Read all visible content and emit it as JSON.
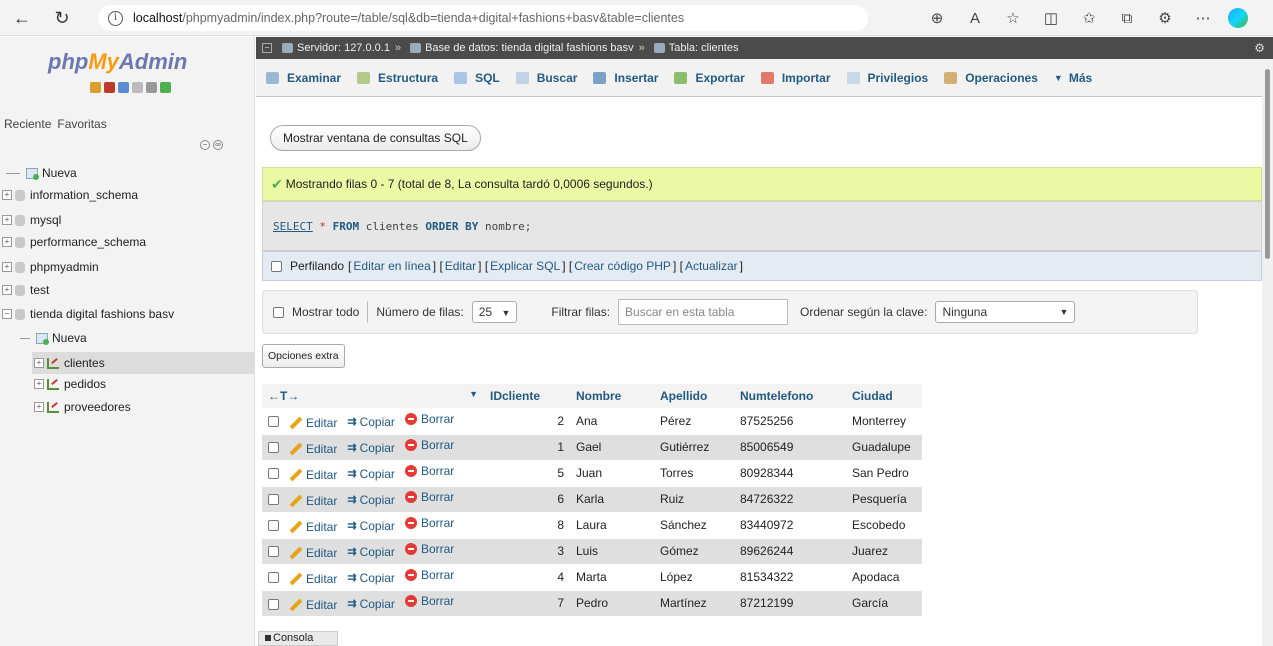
{
  "browser": {
    "url_host": "localhost",
    "url_rest": "/phpmyadmin/index.php?route=/table/sql&db=tienda+digital+fashions+basv&table=clientes"
  },
  "sidebar": {
    "logo_php": "php",
    "logo_my": "My",
    "logo_admin": "Admin",
    "recent": "Reciente",
    "favorites": "Favoritas",
    "tree": [
      {
        "label": "Nueva"
      },
      {
        "label": "information_schema"
      },
      {
        "label": "mysql"
      },
      {
        "label": "performance_schema"
      },
      {
        "label": "phpmyadmin"
      },
      {
        "label": "test"
      },
      {
        "label": "tienda digital fashions basv"
      },
      {
        "label": "Nueva"
      },
      {
        "label": "clientes"
      },
      {
        "label": "pedidos"
      },
      {
        "label": "proveedores"
      }
    ]
  },
  "breadcrumb": {
    "server": "Servidor: 127.0.0.1",
    "database": "Base de datos: tienda digital fashions basv",
    "table": "Tabla: clientes"
  },
  "tabs": [
    "Examinar",
    "Estructura",
    "SQL",
    "Buscar",
    "Insertar",
    "Exportar",
    "Importar",
    "Privilegios",
    "Operaciones",
    "Más"
  ],
  "show_sql_button": "Mostrar ventana de consultas SQL",
  "success_message": "Mostrando filas 0 - 7 (total de 8, La consulta tardó 0,0006 segundos.)",
  "sql": {
    "select": "SELECT",
    "star": "*",
    "from": "FROM",
    "table": "clientes",
    "order_by": "ORDER BY",
    "column": "nombre;"
  },
  "profiling": {
    "label": "Perfilando",
    "links": [
      "Editar en línea",
      "Editar",
      "Explicar SQL",
      "Crear código PHP",
      "Actualizar"
    ]
  },
  "nav": {
    "show_all": "Mostrar todo",
    "rows_label": "Número de filas:",
    "rows_value": "25",
    "filter_label": "Filtrar filas:",
    "filter_placeholder": "Buscar en esta tabla",
    "sort_label": "Ordenar según la clave:",
    "sort_value": "Ninguna"
  },
  "extra_options": "Opciones extra",
  "table": {
    "headers": [
      "IDcliente",
      "Nombre",
      "Apellido",
      "Numtelefono",
      "Ciudad"
    ],
    "actions": {
      "edit": "Editar",
      "copy": "Copiar",
      "delete": "Borrar"
    },
    "rows": [
      [
        "2",
        "Ana",
        "Pérez",
        "87525256",
        "Monterrey"
      ],
      [
        "1",
        "Gael",
        "Gutiérrez",
        "85006549",
        "Guadalupe"
      ],
      [
        "5",
        "Juan",
        "Torres",
        "80928344",
        "San Pedro"
      ],
      [
        "6",
        "Karla",
        "Ruiz",
        "84726322",
        "Pesquería"
      ],
      [
        "8",
        "Laura",
        "Sánchez",
        "83440972",
        "Escobedo"
      ],
      [
        "3",
        "Luis",
        "Gómez",
        "89626244",
        "Juarez"
      ],
      [
        "4",
        "Marta",
        "López",
        "81534322",
        "Apodaca"
      ],
      [
        "7",
        "Pedro",
        "Martínez",
        "87212199",
        "García"
      ]
    ]
  },
  "console_label": "Consola",
  "colors": {
    "link": "#235a81",
    "success_bg": "#ebf8a4",
    "server_bar": "#4b4b4b"
  }
}
